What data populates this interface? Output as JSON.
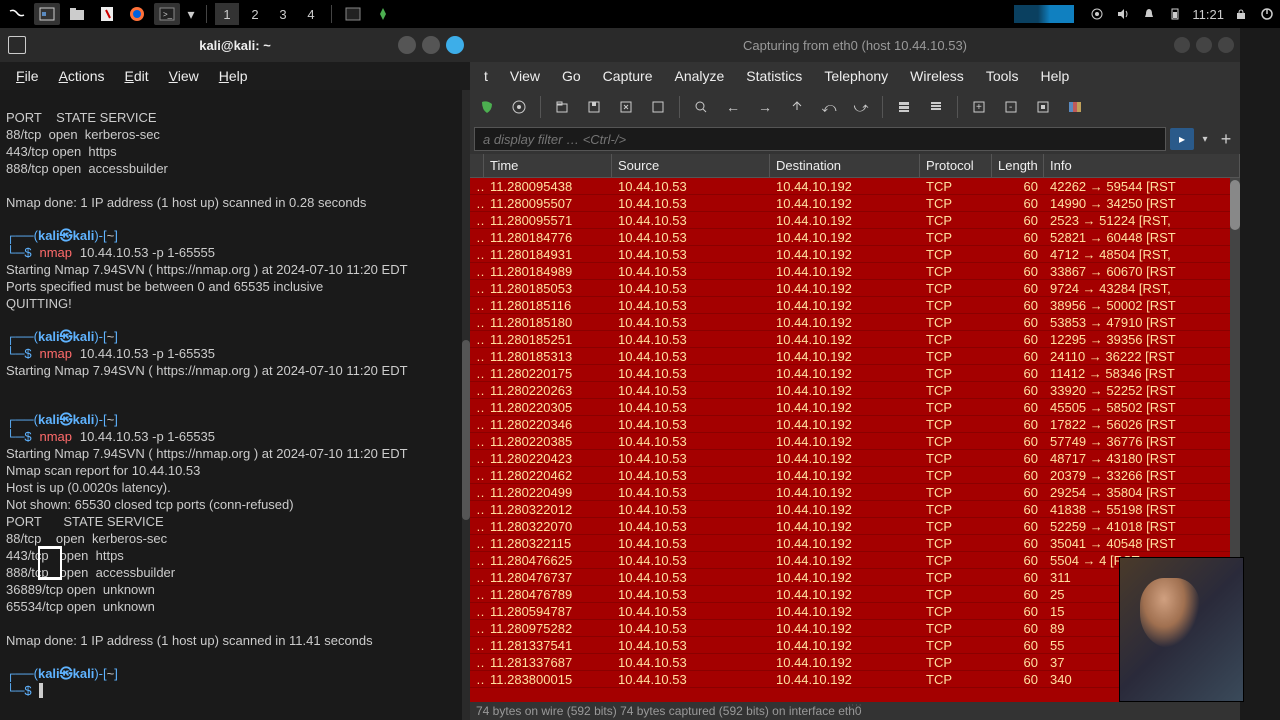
{
  "taskbar": {
    "workspaces": [
      "1",
      "2",
      "3",
      "4"
    ],
    "time": "11:21"
  },
  "terminal": {
    "title": "kali@kali: ~",
    "menus": [
      "File",
      "Actions",
      "Edit",
      "View",
      "Help"
    ],
    "output1": "PORT    STATE SERVICE\n88/tcp  open  kerberos-sec\n443/tcp open  https\n888/tcp open  accessbuilder\n\nNmap done: 1 IP address (1 host up) scanned in 0.28 seconds",
    "prompt_user": "kali㉿kali",
    "prompt_path": "~",
    "cmd1": "nmap",
    "cmd1_args": "10.44.10.53 -p 1-65555",
    "output2": "Starting Nmap 7.94SVN ( https://nmap.org ) at 2024-07-10 11:20 EDT\nPorts specified must be between 0 and 65535 inclusive\nQUITTING!",
    "cmd2": "nmap",
    "cmd2_args": "10.44.10.53 -p 1-65535",
    "output3": "Starting Nmap 7.94SVN ( https://nmap.org ) at 2024-07-10 11:20 EDT",
    "cmd3": "nmap",
    "cmd3_args": "10.44.10.53 -p 1-65535",
    "output4": "Starting Nmap 7.94SVN ( https://nmap.org ) at 2024-07-10 11:20 EDT\nNmap scan report for 10.44.10.53\nHost is up (0.0020s latency).\nNot shown: 65530 closed tcp ports (conn-refused)\nPORT      STATE SERVICE\n88/tcp    open  kerberos-sec\n443/tcp   open  https\n888/tcp   open  accessbuilder\n36889/tcp open  unknown\n65534/tcp open  unknown\n\nNmap done: 1 IP address (1 host up) scanned in 11.41 seconds"
  },
  "wireshark": {
    "title": "Capturing from eth0 (host 10.44.10.53)",
    "menus": [
      "t",
      "View",
      "Go",
      "Capture",
      "Analyze",
      "Statistics",
      "Telephony",
      "Wireless",
      "Tools",
      "Help"
    ],
    "filter_placeholder": "a display filter … <Ctrl-/>",
    "columns": {
      "time": "Time",
      "src": "Source",
      "dst": "Destination",
      "proto": "Protocol",
      "len": "Length",
      "info": "Info"
    },
    "packets": [
      {
        "time": "11.280095438",
        "src": "10.44.10.53",
        "dst": "10.44.10.192",
        "proto": "TCP",
        "len": "60",
        "info": "42262 → 59544 [RST"
      },
      {
        "time": "11.280095507",
        "src": "10.44.10.53",
        "dst": "10.44.10.192",
        "proto": "TCP",
        "len": "60",
        "info": "14990 → 34250 [RST"
      },
      {
        "time": "11.280095571",
        "src": "10.44.10.53",
        "dst": "10.44.10.192",
        "proto": "TCP",
        "len": "60",
        "info": "2523 → 51224 [RST,"
      },
      {
        "time": "11.280184776",
        "src": "10.44.10.53",
        "dst": "10.44.10.192",
        "proto": "TCP",
        "len": "60",
        "info": "52821 → 60448 [RST"
      },
      {
        "time": "11.280184931",
        "src": "10.44.10.53",
        "dst": "10.44.10.192",
        "proto": "TCP",
        "len": "60",
        "info": "4712 → 48504 [RST,"
      },
      {
        "time": "11.280184989",
        "src": "10.44.10.53",
        "dst": "10.44.10.192",
        "proto": "TCP",
        "len": "60",
        "info": "33867 → 60670 [RST"
      },
      {
        "time": "11.280185053",
        "src": "10.44.10.53",
        "dst": "10.44.10.192",
        "proto": "TCP",
        "len": "60",
        "info": "9724 → 43284 [RST,"
      },
      {
        "time": "11.280185116",
        "src": "10.44.10.53",
        "dst": "10.44.10.192",
        "proto": "TCP",
        "len": "60",
        "info": "38956 → 50002 [RST"
      },
      {
        "time": "11.280185180",
        "src": "10.44.10.53",
        "dst": "10.44.10.192",
        "proto": "TCP",
        "len": "60",
        "info": "53853 → 47910 [RST"
      },
      {
        "time": "11.280185251",
        "src": "10.44.10.53",
        "dst": "10.44.10.192",
        "proto": "TCP",
        "len": "60",
        "info": "12295 → 39356 [RST"
      },
      {
        "time": "11.280185313",
        "src": "10.44.10.53",
        "dst": "10.44.10.192",
        "proto": "TCP",
        "len": "60",
        "info": "24110 → 36222 [RST"
      },
      {
        "time": "11.280220175",
        "src": "10.44.10.53",
        "dst": "10.44.10.192",
        "proto": "TCP",
        "len": "60",
        "info": "11412 → 58346 [RST"
      },
      {
        "time": "11.280220263",
        "src": "10.44.10.53",
        "dst": "10.44.10.192",
        "proto": "TCP",
        "len": "60",
        "info": "33920 → 52252 [RST"
      },
      {
        "time": "11.280220305",
        "src": "10.44.10.53",
        "dst": "10.44.10.192",
        "proto": "TCP",
        "len": "60",
        "info": "45505 → 58502 [RST"
      },
      {
        "time": "11.280220346",
        "src": "10.44.10.53",
        "dst": "10.44.10.192",
        "proto": "TCP",
        "len": "60",
        "info": "17822 → 56026 [RST"
      },
      {
        "time": "11.280220385",
        "src": "10.44.10.53",
        "dst": "10.44.10.192",
        "proto": "TCP",
        "len": "60",
        "info": "57749 → 36776 [RST"
      },
      {
        "time": "11.280220423",
        "src": "10.44.10.53",
        "dst": "10.44.10.192",
        "proto": "TCP",
        "len": "60",
        "info": "48717 → 43180 [RST"
      },
      {
        "time": "11.280220462",
        "src": "10.44.10.53",
        "dst": "10.44.10.192",
        "proto": "TCP",
        "len": "60",
        "info": "20379 → 33266 [RST"
      },
      {
        "time": "11.280220499",
        "src": "10.44.10.53",
        "dst": "10.44.10.192",
        "proto": "TCP",
        "len": "60",
        "info": "29254 → 35804 [RST"
      },
      {
        "time": "11.280322012",
        "src": "10.44.10.53",
        "dst": "10.44.10.192",
        "proto": "TCP",
        "len": "60",
        "info": "41838 → 55198 [RST"
      },
      {
        "time": "11.280322070",
        "src": "10.44.10.53",
        "dst": "10.44.10.192",
        "proto": "TCP",
        "len": "60",
        "info": "52259 → 41018 [RST"
      },
      {
        "time": "11.280322115",
        "src": "10.44.10.53",
        "dst": "10.44.10.192",
        "proto": "TCP",
        "len": "60",
        "info": "35041 → 40548 [RST"
      },
      {
        "time": "11.280476625",
        "src": "10.44.10.53",
        "dst": "10.44.10.192",
        "proto": "TCP",
        "len": "60",
        "info": "5504 → 4     [RST,"
      },
      {
        "time": "11.280476737",
        "src": "10.44.10.53",
        "dst": "10.44.10.192",
        "proto": "TCP",
        "len": "60",
        "info": "311"
      },
      {
        "time": "11.280476789",
        "src": "10.44.10.53",
        "dst": "10.44.10.192",
        "proto": "TCP",
        "len": "60",
        "info": "25"
      },
      {
        "time": "11.280594787",
        "src": "10.44.10.53",
        "dst": "10.44.10.192",
        "proto": "TCP",
        "len": "60",
        "info": "15"
      },
      {
        "time": "11.280975282",
        "src": "10.44.10.53",
        "dst": "10.44.10.192",
        "proto": "TCP",
        "len": "60",
        "info": "89"
      },
      {
        "time": "11.281337541",
        "src": "10.44.10.53",
        "dst": "10.44.10.192",
        "proto": "TCP",
        "len": "60",
        "info": "55"
      },
      {
        "time": "11.281337687",
        "src": "10.44.10.53",
        "dst": "10.44.10.192",
        "proto": "TCP",
        "len": "60",
        "info": "37"
      },
      {
        "time": "11.283800015",
        "src": "10.44.10.53",
        "dst": "10.44.10.192",
        "proto": "TCP",
        "len": "60",
        "info": "340"
      }
    ],
    "statusbar": "74 bytes on wire (592 bits)  74 bytes captured (592 bits) on interface eth0"
  }
}
